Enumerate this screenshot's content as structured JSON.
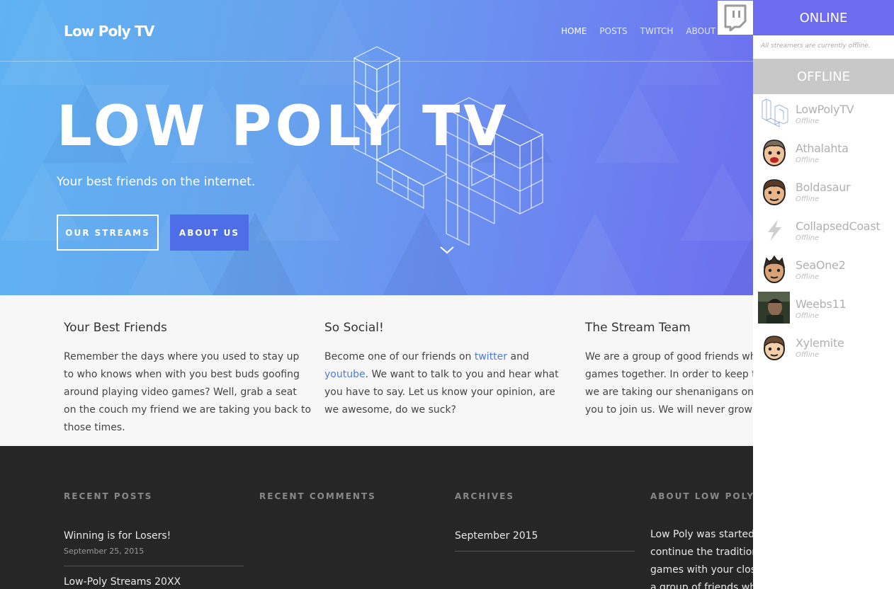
{
  "header": {
    "brand": "Low Poly TV",
    "nav": [
      "HOME",
      "POSTS",
      "TWITCH",
      "ABOUT U"
    ]
  },
  "hero": {
    "title": "LOW POLY TV",
    "subtitle": "Your best friends on the internet.",
    "btn_streams": "OUR STREAMS",
    "btn_about": "ABOUT US"
  },
  "features": [
    {
      "title": "Your Best Friends",
      "text": "Remember the days where you used to stay up to who knows when with you best buds goofing around playing video games? Well, grab a seat on the couch my friend we are taking you back to those times."
    },
    {
      "title": "So Social!",
      "text_pre": "Become one of our friends on ",
      "link1": "twitter",
      "text_mid": " and ",
      "link2": "youtube",
      "text_post": ". We want to talk to you and hear what you have to say. Let us know your opinion, are we awesome, do we suck?"
    },
    {
      "title": "The Stream Team",
      "lines": [
        "We are a group of good friends who",
        "games together. In order to keep the",
        "we are taking our shenanigans onlin",
        "you to join us. We will never grow up"
      ]
    }
  ],
  "footer": {
    "recent_posts_heading": "RECENT POSTS",
    "recent_comments_heading": "RECENT COMMENTS",
    "archives_heading": "ARCHIVES",
    "about_heading": "ABOUT LOW POLY",
    "posts": [
      {
        "title": "Winning is for Losers!",
        "date": "September 25, 2015"
      },
      {
        "title": "Low-Poly Streams 20XX"
      }
    ],
    "archives": [
      "September 2015"
    ],
    "about_lines": [
      "Low Poly was started i",
      "continue the tradition",
      "games with your close",
      "a group of friends who"
    ]
  },
  "sidebar": {
    "online_heading": "ONLINE",
    "online_note": "All streamers are currently offline.",
    "offline_heading": "OFFLINE",
    "streamers": [
      {
        "name": "LowPolyTV",
        "status": "Offline",
        "avatar": "lp-logo-icon"
      },
      {
        "name": "Athalahta",
        "status": "Offline",
        "avatar": "cartoon-face-icon"
      },
      {
        "name": "Boldasaur",
        "status": "Offline",
        "avatar": "cartoon-face-icon"
      },
      {
        "name": "CollapsedCoast",
        "status": "Offline",
        "avatar": "lightning-icon"
      },
      {
        "name": "SeaOne2",
        "status": "Offline",
        "avatar": "cartoon-face-icon"
      },
      {
        "name": "Weebs11",
        "status": "Offline",
        "avatar": "photo-avatar"
      },
      {
        "name": "Xylemite",
        "status": "Offline",
        "avatar": "cartoon-face-icon"
      }
    ]
  },
  "colors": {
    "online_accent": "#6d6cf0",
    "offline_gray": "#c8c8c8",
    "hero_left": "#5fb3f2",
    "hero_right": "#6f6cee",
    "about_button": "#4e6ee8",
    "link": "#4e7bd8",
    "footer_bg": "#262626"
  }
}
